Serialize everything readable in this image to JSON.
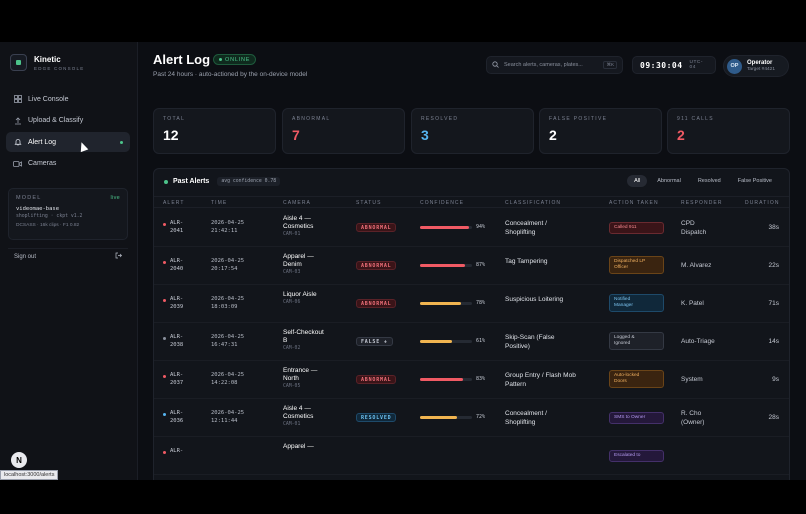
{
  "brand": {
    "name": "Kinetic",
    "sub": "EDGE CONSOLE"
  },
  "nav": [
    {
      "label": "Live Console",
      "icon": "grid-icon",
      "active": false
    },
    {
      "label": "Upload & Classify",
      "icon": "upload-icon",
      "active": false
    },
    {
      "label": "Alert Log",
      "icon": "bell-icon",
      "active": true
    },
    {
      "label": "Cameras",
      "icon": "camera-icon",
      "active": false
    }
  ],
  "model": {
    "label": "MODEL",
    "status": "live",
    "name": "videomae-base",
    "version": "shoplifting · ckpt v1.2",
    "stats": "DCSASS · 16k clips · F1 0.82"
  },
  "signout": {
    "label": "Sign out"
  },
  "header": {
    "title": "Alert Log",
    "badge": "ONLINE",
    "subtitle": "Past 24 hours · auto-actioned by the on-device model",
    "search_placeholder": "Search alerts, cameras, plates...",
    "kbd": "⌘K",
    "time": "09:30:04",
    "tz": "UTC-04",
    "user_initials": "OP",
    "user_name": "Operator",
    "user_sub": "Target #4421"
  },
  "stats": [
    {
      "label": "TOTAL",
      "value": "12",
      "color": "#ffffff"
    },
    {
      "label": "ABNORMAL",
      "value": "7",
      "color": "#f05a64"
    },
    {
      "label": "RESOLVED",
      "value": "3",
      "color": "#56b4f0"
    },
    {
      "label": "FALSE POSITIVE",
      "value": "2",
      "color": "#ffffff"
    },
    {
      "label": "911 CALLS",
      "value": "2",
      "color": "#f05a64"
    }
  ],
  "table": {
    "title": "Past Alerts",
    "confidence_pill": "avg confidence 0.78",
    "filters": [
      "All",
      "Abnormal",
      "Resolved",
      "False Positive"
    ],
    "columns": [
      "ALERT",
      "TIME",
      "CAMERA",
      "STATUS",
      "CONFIDENCE",
      "CLASSIFICATION",
      "ACTION TAKEN",
      "RESPONDER",
      "DURATION"
    ],
    "rows": [
      {
        "id1": "ALR-",
        "id2": "2041",
        "sev": "#f05a64",
        "date": "2026-04-25",
        "time": "21:42:11",
        "cam1": "Aisle 4 —",
        "cam2": "Cosmetics",
        "camid": "CAM-01",
        "status": "ABNORMAL",
        "confidence": 0.94,
        "conf_label": "94%",
        "conf_color": "#f05a64",
        "cls1": "Concealment /",
        "cls2": "Shoplifting",
        "action1": "Called 911",
        "action2": "",
        "action_theme": "red",
        "resp1": "CPD",
        "resp2": "Dispatch",
        "duration": "38s"
      },
      {
        "id1": "ALR-",
        "id2": "2040",
        "sev": "#f05a64",
        "date": "2026-04-25",
        "time": "20:17:54",
        "cam1": "Apparel —",
        "cam2": "Denim",
        "camid": "CAM-03",
        "status": "ABNORMAL",
        "confidence": 0.87,
        "conf_label": "87%",
        "conf_color": "#f05a64",
        "cls1": "Tag Tampering",
        "cls2": "",
        "action1": "Dispatched LP",
        "action2": "Officer",
        "action_theme": "orange",
        "resp1": "M. Alvarez",
        "resp2": "",
        "duration": "22s"
      },
      {
        "id1": "ALR-",
        "id2": "2039",
        "sev": "#f05a64",
        "date": "2026-04-25",
        "time": "18:03:09",
        "cam1": "Liquor Aisle",
        "cam2": "",
        "camid": "CAM-06",
        "status": "ABNORMAL",
        "confidence": 0.78,
        "conf_label": "78%",
        "conf_color": "#f0b450",
        "cls1": "Suspicious Loitering",
        "cls2": "",
        "action1": "Notified",
        "action2": "Manager",
        "action_theme": "blue",
        "resp1": "K. Patel",
        "resp2": "",
        "duration": "71s"
      },
      {
        "id1": "ALR-",
        "id2": "2038",
        "sev": "#8a909d",
        "date": "2026-04-25",
        "time": "16:47:31",
        "cam1": "Self-Checkout",
        "cam2": "B",
        "camid": "CAM-02",
        "status": "FALSE +",
        "confidence": 0.61,
        "conf_label": "61%",
        "conf_color": "#f0b450",
        "cls1": "Skip-Scan (False",
        "cls2": "Positive)",
        "action1": "Logged &",
        "action2": "Ignored",
        "action_theme": "gray",
        "resp1": "Auto-Triage",
        "resp2": "",
        "duration": "14s"
      },
      {
        "id1": "ALR-",
        "id2": "2037",
        "sev": "#f05a64",
        "date": "2026-04-25",
        "time": "14:22:08",
        "cam1": "Entrance —",
        "cam2": "North",
        "camid": "CAM-05",
        "status": "ABNORMAL",
        "confidence": 0.83,
        "conf_label": "83%",
        "conf_color": "#f05a64",
        "cls1": "Group Entry / Flash Mob",
        "cls2": "Pattern",
        "action1": "Auto-locked",
        "action2": "Doors",
        "action_theme": "orange",
        "resp1": "System",
        "resp2": "",
        "duration": "9s"
      },
      {
        "id1": "ALR-",
        "id2": "2036",
        "sev": "#56b4f0",
        "date": "2026-04-25",
        "time": "12:11:44",
        "cam1": "Aisle 4 —",
        "cam2": "Cosmetics",
        "camid": "CAM-01",
        "status": "RESOLVED",
        "confidence": 0.72,
        "conf_label": "72%",
        "conf_color": "#f0b450",
        "cls1": "Concealment /",
        "cls2": "Shoplifting",
        "action1": "SMS to Owner",
        "action2": "",
        "action_theme": "purple",
        "resp1": "R. Cho",
        "resp2": "(Owner)",
        "duration": "28s"
      },
      {
        "id1": "ALR-",
        "id2": "",
        "sev": "#f05a64",
        "date": "",
        "time": "",
        "cam1": "Apparel —",
        "cam2": "",
        "camid": "",
        "status": "",
        "confidence": 0,
        "conf_label": "",
        "conf_color": "#f05a64",
        "cls1": "",
        "cls2": "",
        "action1": "Escalated to",
        "action2": "",
        "action_theme": "purple",
        "resp1": "",
        "resp2": "",
        "duration": ""
      }
    ]
  },
  "url_tip": "localhost:3000/alerts",
  "colors": {
    "accent": "#4cc38a",
    "danger": "#f05a64",
    "info": "#56b4f0",
    "warn": "#f0b450"
  }
}
